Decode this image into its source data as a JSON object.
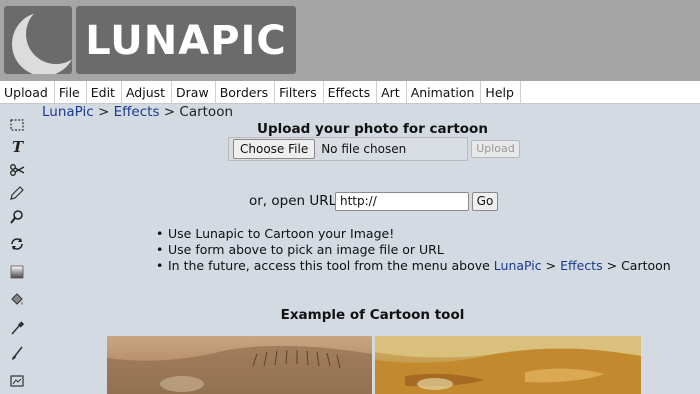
{
  "header": {
    "logo_text": "LUNAPIC"
  },
  "menubar": {
    "items": [
      "Upload",
      "File",
      "Edit",
      "Adjust",
      "Draw",
      "Borders",
      "Filters",
      "Effects",
      "Art",
      "Animation",
      "Help"
    ]
  },
  "toolbar": {
    "tools": [
      "select-icon",
      "text-icon",
      "scissors-icon",
      "pencil-icon",
      "zoom-icon",
      "rotate-icon",
      "gradient-icon",
      "paint-bucket-icon",
      "eyedropper-icon",
      "brush-icon",
      "crop-icon"
    ]
  },
  "breadcrumb": {
    "root": "LunaPic",
    "sep1": ">",
    "section": "Effects",
    "sep2": ">",
    "current": "Cartoon"
  },
  "upload": {
    "title": "Upload your photo for cartoon",
    "choose_label": "Choose File",
    "file_status": "No file chosen",
    "upload_label": "Upload"
  },
  "url": {
    "label": "or, open URL",
    "value": "http://",
    "go_label": "Go"
  },
  "bullets": {
    "item1": "Use Lunapic to Cartoon your Image!",
    "item2": "Use form above to pick an image file or URL",
    "item3_prefix": "In the future, access this tool from the menu above",
    "item3_link1": "LunaPic",
    "item3_sep1": ">",
    "item3_link2": "Effects",
    "item3_sep2": ">",
    "item3_suffix": "Cartoon"
  },
  "example": {
    "title": "Example of Cartoon tool"
  },
  "colors": {
    "link": "#1a3a8f",
    "background": "#d3dae1",
    "header": "#a5a5a5",
    "logo_box": "#6b6b6b"
  }
}
